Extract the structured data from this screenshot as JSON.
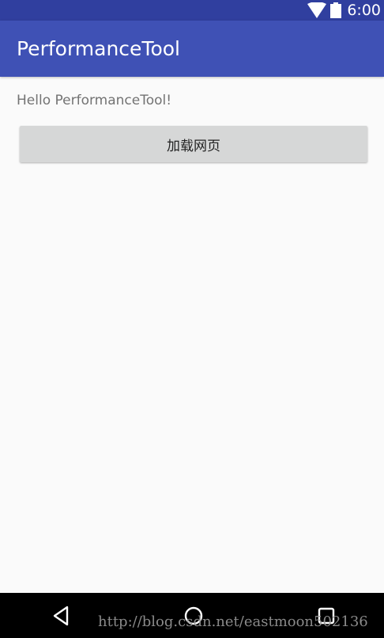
{
  "status_bar": {
    "time": "6:00",
    "wifi_icon": "wifi-icon",
    "battery_icon": "battery-icon"
  },
  "app_bar": {
    "title": "PerformanceTool"
  },
  "content": {
    "hello_text": "Hello PerformanceTool!",
    "load_button_label": "加载网页"
  },
  "nav_bar": {
    "back_icon": "back-icon",
    "home_icon": "home-icon",
    "recents_icon": "recents-icon"
  },
  "watermark": "http://blog.csdn.net/eastmoon502136",
  "colors": {
    "status_bar": "#303f9f",
    "app_bar": "#3f51b5",
    "background": "#fafafa",
    "button": "#d6d7d7",
    "nav_bar": "#000000"
  }
}
